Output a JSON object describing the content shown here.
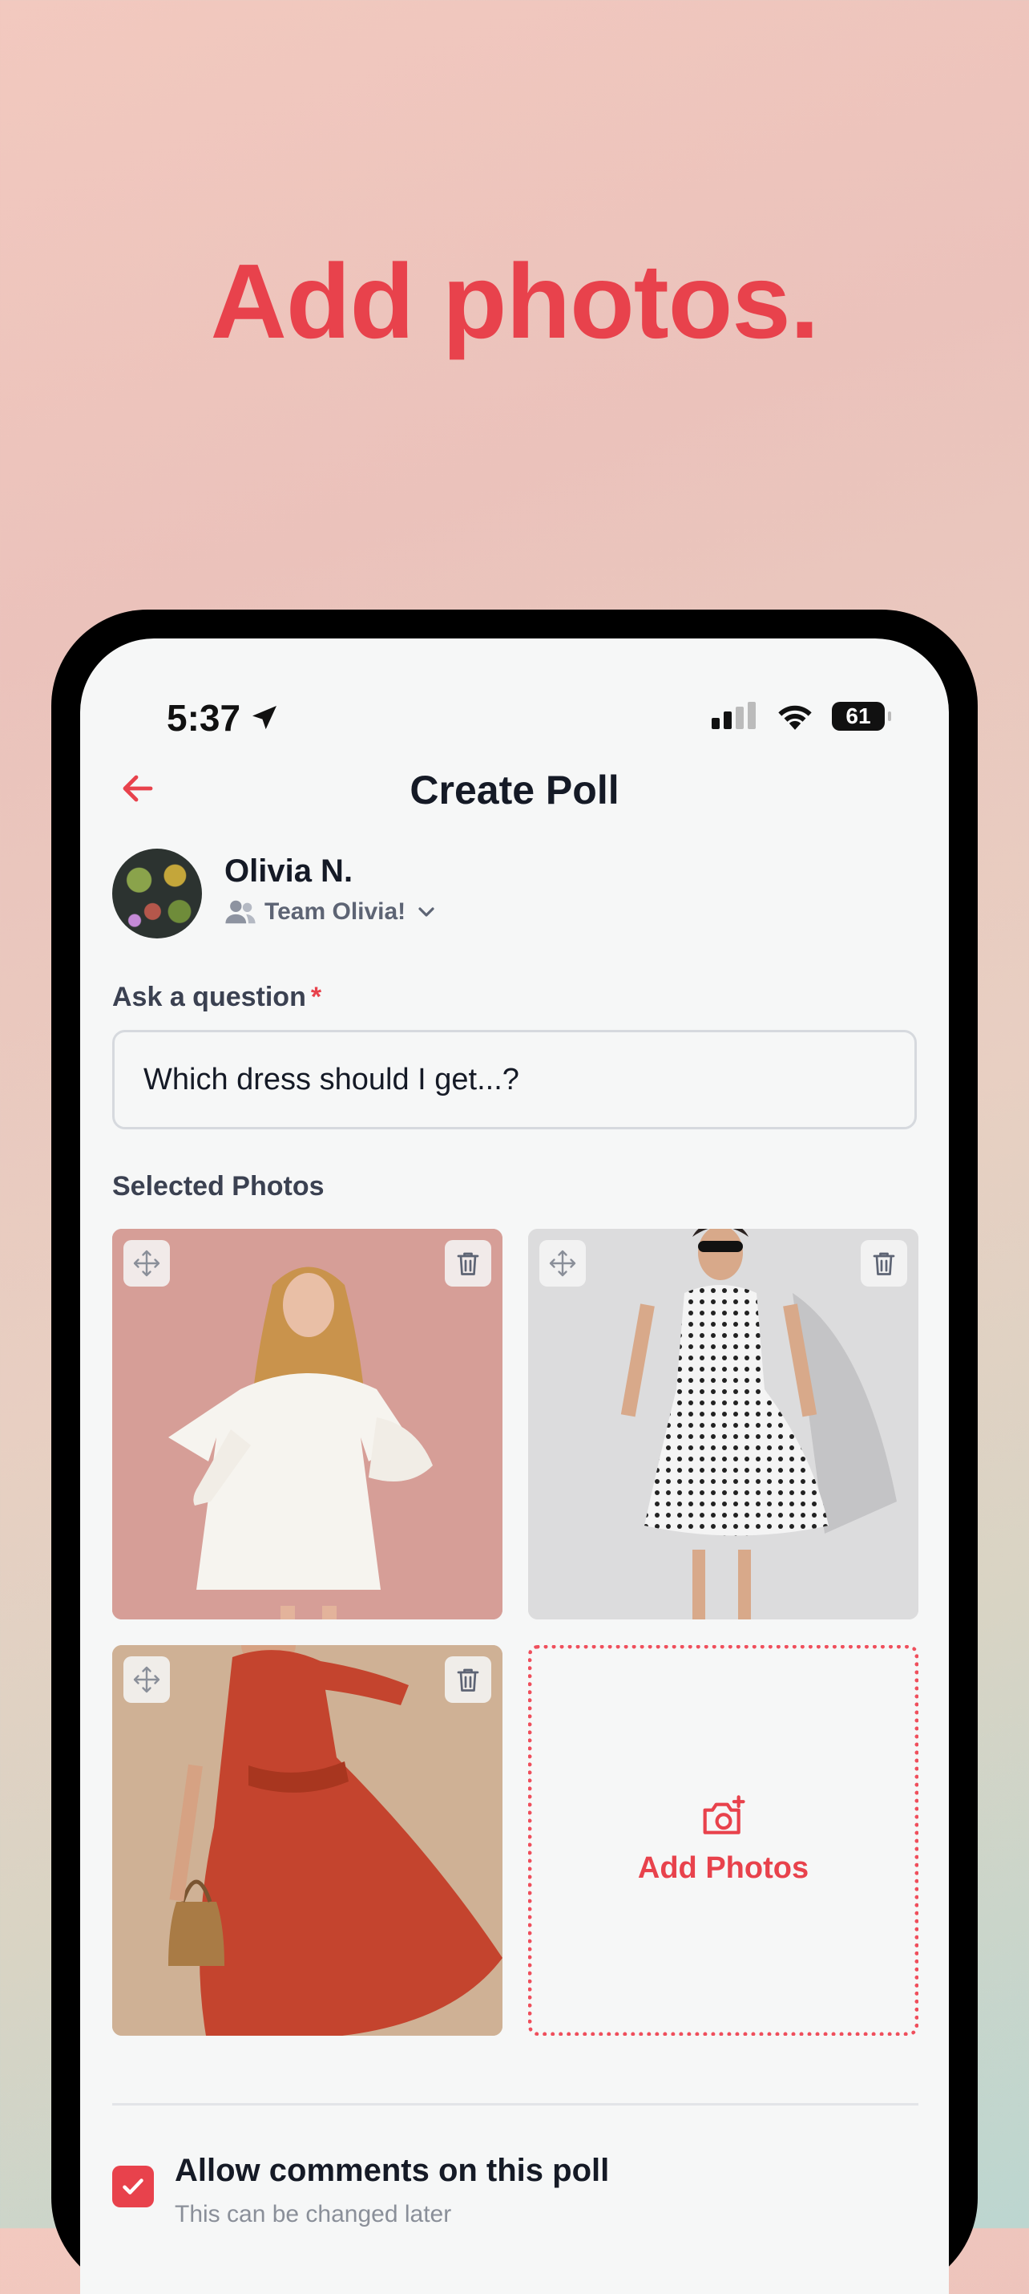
{
  "headline": "Add photos.",
  "status_bar": {
    "time": "5:37",
    "battery": "61"
  },
  "header": {
    "title": "Create Poll"
  },
  "user": {
    "name": "Olivia N.",
    "team": "Team Olivia!"
  },
  "question": {
    "label": "Ask a question",
    "required_marker": "*",
    "value": "Which dress should I get...?"
  },
  "photos": {
    "label": "Selected Photos",
    "items": [
      {
        "description": "woman in white puff-sleeve dress"
      },
      {
        "description": "woman in polka-dot dress"
      },
      {
        "description": "woman in red wrap dress"
      }
    ],
    "add_label": "Add Photos"
  },
  "comments": {
    "title": "Allow comments on this poll",
    "subtitle": "This can be changed later",
    "checked": true
  },
  "colors": {
    "accent": "#e8424c",
    "text": "#151a26",
    "muted": "#8a8f99"
  }
}
